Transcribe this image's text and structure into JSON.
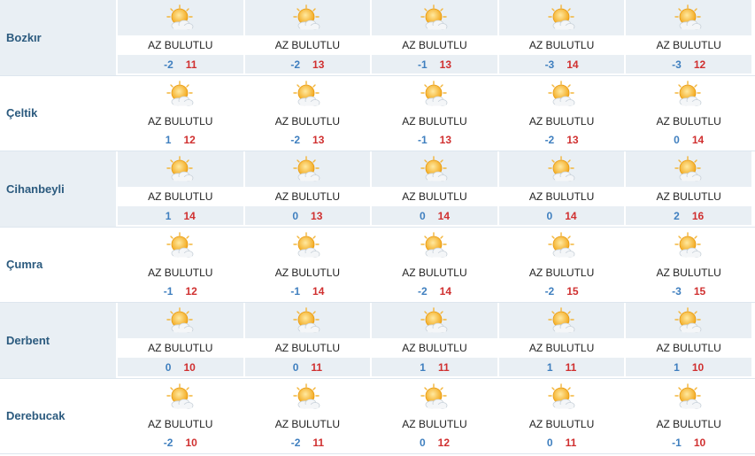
{
  "condition_icon": "partly-cloudy-sun-icon",
  "colors": {
    "min_temp": "#3f7fbf",
    "max_temp": "#d03030",
    "city": "#2b5a7e",
    "stripe": "#e9eff4"
  },
  "rows": [
    {
      "city": "Bozkır",
      "days": [
        {
          "cond": "AZ BULUTLU",
          "min": "-2",
          "max": "11"
        },
        {
          "cond": "AZ BULUTLU",
          "min": "-2",
          "max": "13"
        },
        {
          "cond": "AZ BULUTLU",
          "min": "-1",
          "max": "13"
        },
        {
          "cond": "AZ BULUTLU",
          "min": "-3",
          "max": "14"
        },
        {
          "cond": "AZ BULUTLU",
          "min": "-3",
          "max": "12"
        }
      ]
    },
    {
      "city": "Çeltik",
      "days": [
        {
          "cond": "AZ BULUTLU",
          "min": "1",
          "max": "12"
        },
        {
          "cond": "AZ BULUTLU",
          "min": "-2",
          "max": "13"
        },
        {
          "cond": "AZ BULUTLU",
          "min": "-1",
          "max": "13"
        },
        {
          "cond": "AZ BULUTLU",
          "min": "-2",
          "max": "13"
        },
        {
          "cond": "AZ BULUTLU",
          "min": "0",
          "max": "14"
        }
      ]
    },
    {
      "city": "Cihanbeyli",
      "days": [
        {
          "cond": "AZ BULUTLU",
          "min": "1",
          "max": "14"
        },
        {
          "cond": "AZ BULUTLU",
          "min": "0",
          "max": "13"
        },
        {
          "cond": "AZ BULUTLU",
          "min": "0",
          "max": "14"
        },
        {
          "cond": "AZ BULUTLU",
          "min": "0",
          "max": "14"
        },
        {
          "cond": "AZ BULUTLU",
          "min": "2",
          "max": "16"
        }
      ]
    },
    {
      "city": "Çumra",
      "days": [
        {
          "cond": "AZ BULUTLU",
          "min": "-1",
          "max": "12"
        },
        {
          "cond": "AZ BULUTLU",
          "min": "-1",
          "max": "14"
        },
        {
          "cond": "AZ BULUTLU",
          "min": "-2",
          "max": "14"
        },
        {
          "cond": "AZ BULUTLU",
          "min": "-2",
          "max": "15"
        },
        {
          "cond": "AZ BULUTLU",
          "min": "-3",
          "max": "15"
        }
      ]
    },
    {
      "city": "Derbent",
      "days": [
        {
          "cond": "AZ BULUTLU",
          "min": "0",
          "max": "10"
        },
        {
          "cond": "AZ BULUTLU",
          "min": "0",
          "max": "11"
        },
        {
          "cond": "AZ BULUTLU",
          "min": "1",
          "max": "11"
        },
        {
          "cond": "AZ BULUTLU",
          "min": "1",
          "max": "11"
        },
        {
          "cond": "AZ BULUTLU",
          "min": "1",
          "max": "10"
        }
      ]
    },
    {
      "city": "Derebucak",
      "days": [
        {
          "cond": "AZ BULUTLU",
          "min": "-2",
          "max": "10"
        },
        {
          "cond": "AZ BULUTLU",
          "min": "-2",
          "max": "11"
        },
        {
          "cond": "AZ BULUTLU",
          "min": "0",
          "max": "12"
        },
        {
          "cond": "AZ BULUTLU",
          "min": "0",
          "max": "11"
        },
        {
          "cond": "AZ BULUTLU",
          "min": "-1",
          "max": "10"
        }
      ]
    }
  ]
}
